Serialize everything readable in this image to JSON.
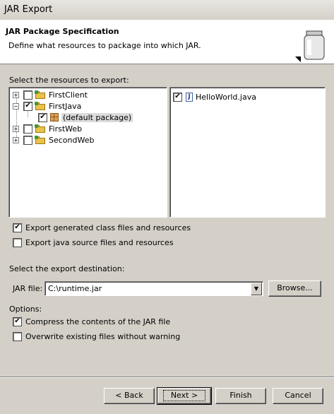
{
  "window": {
    "title": "JAR Export"
  },
  "header": {
    "title": "JAR Package Specification",
    "description": "Define what resources to package into which JAR.",
    "icon": "jar-icon"
  },
  "resources": {
    "label": "Select the resources to export:",
    "tree": [
      {
        "label": "FirstClient",
        "checked": false,
        "expanded": false
      },
      {
        "label": "FirstJava",
        "checked": true,
        "expanded": true
      },
      {
        "label": "(default package)",
        "checked": true,
        "selected": true
      },
      {
        "label": "FirstWeb",
        "checked": false,
        "expanded": false
      },
      {
        "label": "SecondWeb",
        "checked": false,
        "expanded": false
      }
    ],
    "files": [
      {
        "label": "HelloWorld.java",
        "checked": true
      }
    ]
  },
  "options_top": {
    "export_class": {
      "label": "Export generated class files and resources",
      "checked": true
    },
    "export_source": {
      "label": "Export java source files and resources",
      "checked": false
    }
  },
  "destination": {
    "label": "Select the export destination:",
    "jar_label": "JAR file:",
    "jar_value": "C:\\runtime.jar",
    "browse_label": "Browse..."
  },
  "options": {
    "label": "Options:",
    "compress": {
      "label": "Compress the contents of the JAR file",
      "checked": true
    },
    "overwrite": {
      "label": "Overwrite existing files without warning",
      "checked": false
    }
  },
  "buttons": {
    "back": "< Back",
    "next": "Next >",
    "finish": "Finish",
    "cancel": "Cancel"
  },
  "check_glyph": "✔"
}
